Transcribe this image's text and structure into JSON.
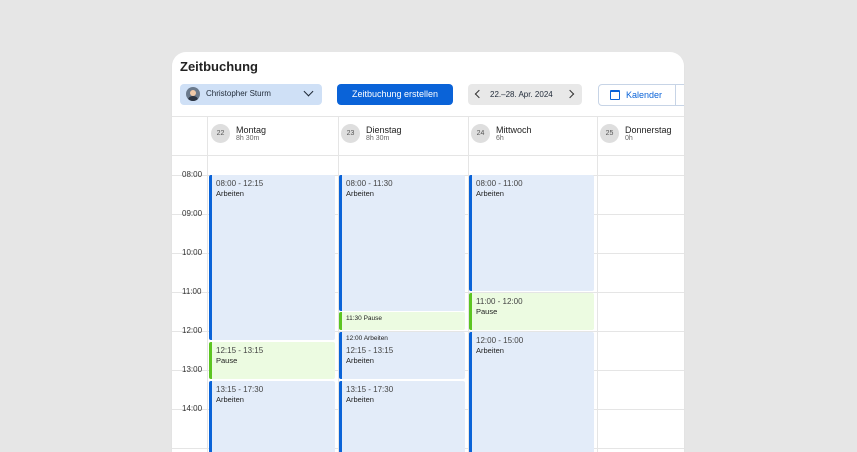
{
  "header": {
    "title": "Zeitbuchung",
    "user_name": "Christopher Sturm",
    "create_button": "Zeitbuchung erstellen",
    "week_range": "22.–28. Apr. 2024",
    "view_kalender": "Kalender"
  },
  "times": [
    "08:00",
    "09:00",
    "10:00",
    "11:00",
    "12:00",
    "13:00",
    "14:00"
  ],
  "days": [
    {
      "num": "22",
      "name": "Montag",
      "hours": "8h 30m"
    },
    {
      "num": "23",
      "name": "Dienstag",
      "hours": "8h 30m"
    },
    {
      "num": "24",
      "name": "Mittwoch",
      "hours": "6h"
    },
    {
      "num": "25",
      "name": "Donnerstag",
      "hours": "0h"
    }
  ],
  "events": {
    "mon_1": {
      "time": "08:00 - 12:15",
      "title": "Arbeiten"
    },
    "mon_2": {
      "time": "12:15 - 13:15",
      "title": "Pause"
    },
    "mon_3": {
      "time": "13:15 - 17:30",
      "title": "Arbeiten"
    },
    "tue_1": {
      "time": "08:00 - 11:30",
      "title": "Arbeiten"
    },
    "tue_2": {
      "title": "11:30 Pause"
    },
    "tue_3": {
      "small": "12:00 Arbeiten",
      "time": "12:15 - 13:15",
      "title": "Arbeiten"
    },
    "tue_4": {
      "time": "13:15 - 17:30",
      "title": "Arbeiten"
    },
    "wed_1": {
      "time": "08:00 - 11:00",
      "title": "Arbeiten"
    },
    "wed_2": {
      "time": "11:00 - 12:00",
      "title": "Pause"
    },
    "wed_3": {
      "time": "12:00 - 15:00",
      "title": "Arbeiten"
    }
  },
  "colors": {
    "primary": "#0a63d8",
    "work_bg": "#e3ecf9",
    "pause_bg": "#ecfbe1",
    "pause_accent": "#5cc521"
  }
}
